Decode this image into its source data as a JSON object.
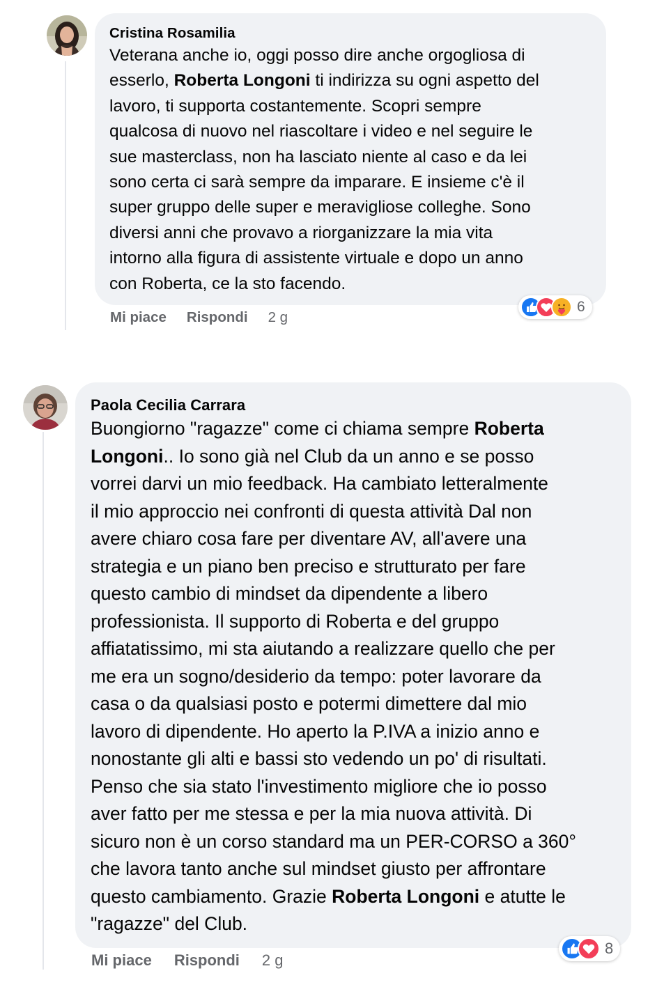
{
  "comments": [
    {
      "author": "Cristina Rosamilia",
      "text_parts": [
        {
          "t": "Veterana anche io, oggi posso dire anche orgogliosa di\nesserlo, ",
          "b": false
        },
        {
          "t": "Roberta Longoni",
          "b": true
        },
        {
          "t": " ti indirizza su ogni aspetto del\nlavoro, ti supporta costantemente. Scopri sempre\nqualcosa di nuovo nel riascoltare i video e nel seguire le\nsue masterclass, non ha lasciato niente al caso e da lei\nsono certa ci sarà sempre da imparare. E insieme c'è il\nsuper gruppo delle super e meravigliose colleghe. Sono\ndiversi anni che provavo a riorganizzare la mia vita\nintorno alla figura di assistente virtuale e dopo un anno\ncon Roberta, ce la sto facendo.",
          "b": false
        }
      ],
      "like_label": "Mi piace",
      "reply_label": "Rispondi",
      "time": "2 g",
      "reactions": [
        "like",
        "love",
        "care"
      ],
      "reaction_count": "6"
    },
    {
      "author": "Paola Cecilia Carrara",
      "text_parts": [
        {
          "t": "Buongiorno \"ragazze\" come ci chiama sempre ",
          "b": false
        },
        {
          "t": "Roberta\nLongoni",
          "b": true
        },
        {
          "t": ".. Io sono già nel Club da un anno e se posso\nvorrei darvi un mio feedback. Ha cambiato letteralmente\nil mio approccio nei confronti di questa attività Dal non\navere chiaro cosa fare per diventare AV, all'avere una\nstrategia e un piano ben preciso e strutturato per fare\nquesto cambio di mindset da dipendente a libero\nprofessionista. Il supporto di Roberta e del gruppo\naffiatatissimo, mi sta aiutando a realizzare quello che per\nme era un sogno/desiderio da tempo: poter lavorare da\ncasa o da qualsiasi posto e potermi dimettere dal mio\nlavoro di dipendente. Ho aperto la P.IVA a inizio anno e\nnonostante gli alti e bassi sto vedendo un po' di risultati.\nPenso che sia stato l'investimento migliore che io posso\naver fatto per me stessa e per la mia nuova attività. Di\nsicuro non è un corso standard ma un PER-CORSO a 360°\nche lavora tanto anche sul mindset giusto per affrontare\nquesto cambiamento. Grazie ",
          "b": false
        },
        {
          "t": "Roberta Longoni",
          "b": true
        },
        {
          "t": " e atutte le\n\"ragazze\" del Club.",
          "b": false
        }
      ],
      "like_label": "Mi piace",
      "reply_label": "Rispondi",
      "time": "2 g",
      "reactions": [
        "like",
        "love"
      ],
      "reaction_count": "8"
    }
  ],
  "colors": {
    "bubble": "#f0f2f5",
    "like": "#1877f2",
    "love": "#f33e58",
    "care": "#f7b125",
    "muted": "#65676b"
  }
}
